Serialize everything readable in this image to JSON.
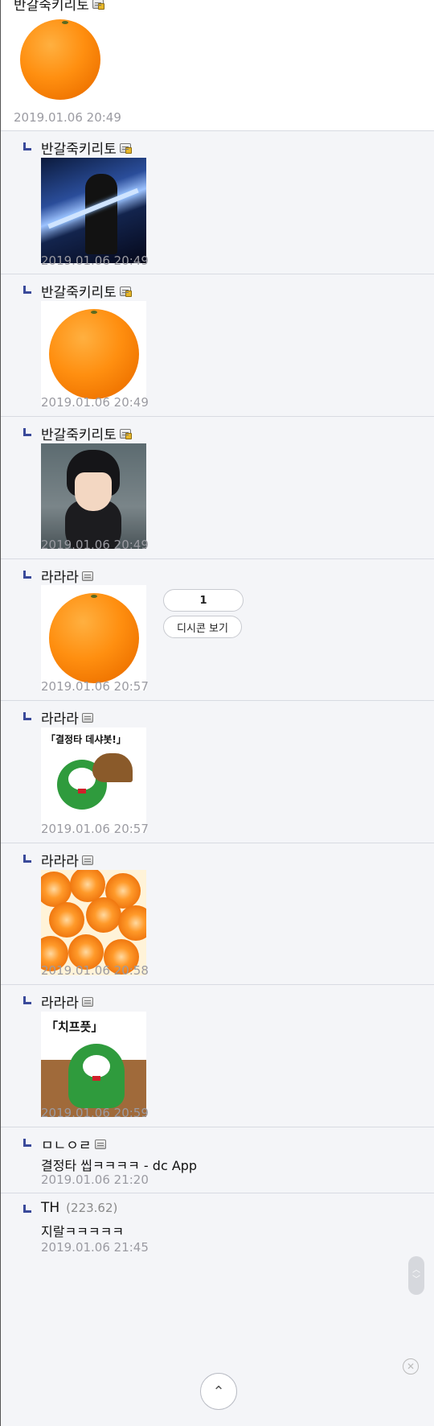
{
  "comments": [
    {
      "nick": "반갈죽키리토",
      "date": "2019.01.06 20:49",
      "image": "orange-photo"
    },
    {
      "nick": "반갈죽키리토",
      "date": "2019.01.06 20:49",
      "image": "anime-sword-image"
    },
    {
      "nick": "반갈죽키리토",
      "date": "2019.01.06 20:49",
      "image": "orange-photo"
    },
    {
      "nick": "반갈죽키리토",
      "date": "2019.01.06 20:49",
      "image": "anime-character-image"
    },
    {
      "nick": "라라라",
      "date": "2019.01.06 20:57",
      "image": "orange-photo",
      "count": "1",
      "dccon_label": "디시콘 보기"
    },
    {
      "nick": "라라라",
      "date": "2019.01.06 20:57",
      "image": "frog-sticker",
      "caption": "「결정타 데샤봇!」"
    },
    {
      "nick": "라라라",
      "date": "2019.01.06 20:58",
      "image": "orange-slices-photo"
    },
    {
      "nick": "라라라",
      "date": "2019.01.06 20:59",
      "image": "frog-sticker",
      "caption": "「치프픗」"
    },
    {
      "nick": "ㅁㄴㅇㄹ",
      "date": "2019.01.06 21:20",
      "text": "결정타 씹ㅋㅋㅋㅋ - dc App"
    },
    {
      "nick": "TH",
      "ip": "(223.62)",
      "date": "2019.01.06 21:45",
      "text": "지랄ㅋㅋㅋㅋㅋ"
    }
  ],
  "icons": {
    "reply": "reply-arrow-icon",
    "member": "member-mark-icon",
    "scroll": "scroll-handle",
    "top": "scroll-top-icon",
    "delete": "delete-icon"
  },
  "colors": {
    "reply_mark": "#3a4a9a",
    "date": "#9b9ba2",
    "background": "#f4f5f8"
  },
  "top_button_label": "⌃",
  "delete_label": "✕"
}
